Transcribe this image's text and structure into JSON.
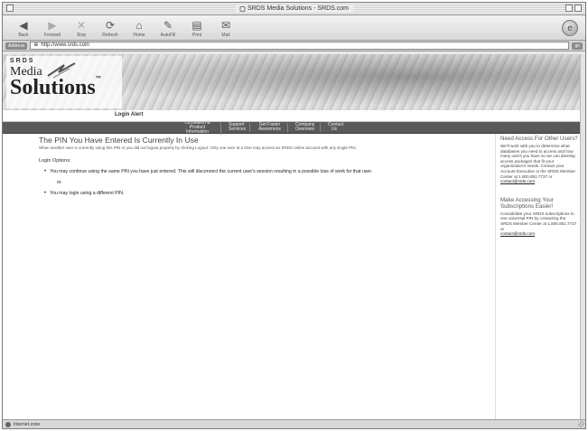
{
  "window": {
    "title": "SRDS Media Solutions - SRDS.com"
  },
  "toolbar": {
    "buttons": [
      {
        "label": "Back",
        "icon": "back-arrow-icon"
      },
      {
        "label": "Forward",
        "icon": "forward-arrow-icon"
      },
      {
        "label": "Stop",
        "icon": "stop-icon"
      },
      {
        "label": "Refresh",
        "icon": "refresh-icon"
      },
      {
        "label": "Home",
        "icon": "home-icon"
      },
      {
        "label": "AutoFill",
        "icon": "autofill-icon"
      },
      {
        "label": "Print",
        "icon": "print-icon"
      },
      {
        "label": "Mail",
        "icon": "mail-icon"
      }
    ]
  },
  "address": {
    "label": "Address",
    "url": "http://www.srds.com",
    "go": "go"
  },
  "logo": {
    "line1": "Media",
    "line2": "Solutions",
    "top": "SRDS",
    "mark": "™"
  },
  "login_alert": "Login Alert",
  "nav": [
    "Circulation & Product Information",
    "Support Services",
    "Get Faster Awareness",
    "Company Overview",
    "Contact Us"
  ],
  "main": {
    "heading": "The PIN You Have Entered Is Currently In Use",
    "intro": "When another user is currently using this PIN or you did not logout properly by clicking Logout. Only one user at a time may access an SRDS online account with any single PIN.",
    "options_title": "Login Options:",
    "option1": "You may continue using the same PIN you have just entered. This will disconnect the current user's session resulting in a possible loss of work for that user.",
    "or": "or",
    "option2": "You may login using a different PIN."
  },
  "sidebar": {
    "block1": {
      "heading": "Need Access For Other Users?",
      "text": "We'll work with you to determine what databases you need to access and how many users you have so we can develop access packages that fit your organization's needs. Contact your Account Executive or the SRDS Member Center at 1.800.851.7737 or",
      "link": "contact@srds.com"
    },
    "block2": {
      "heading": "Make Accessing Your Subscriptions Easier!",
      "text": "Consolidate your SRDS subscriptions to one universal PIN by contacting the SRDS Member Center at 1.800.851.7737 or",
      "link": "contact@srds.com"
    }
  },
  "status": {
    "text": "Internet zone"
  }
}
